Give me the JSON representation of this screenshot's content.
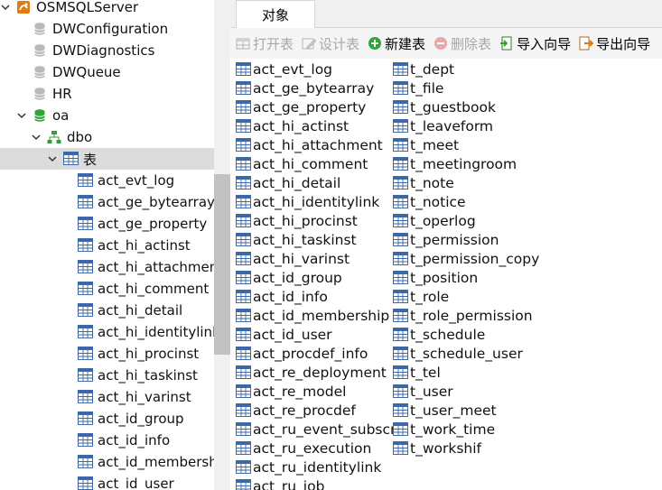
{
  "tree": {
    "items": [
      {
        "label": "OSMSQLServer",
        "level": 0,
        "arrow": "down",
        "icon": "server-icon"
      },
      {
        "label": "DWConfiguration",
        "level": 1,
        "arrow": "none",
        "icon": "database-gray-icon"
      },
      {
        "label": "DWDiagnostics",
        "level": 1,
        "arrow": "none",
        "icon": "database-gray-icon"
      },
      {
        "label": "DWQueue",
        "level": 1,
        "arrow": "none",
        "icon": "database-gray-icon"
      },
      {
        "label": "HR",
        "level": 1,
        "arrow": "none",
        "icon": "database-gray-icon"
      },
      {
        "label": "oa",
        "level": 1,
        "arrow": "down",
        "icon": "database-green-icon"
      },
      {
        "label": "dbo",
        "level": 2,
        "arrow": "down",
        "icon": "schema-icon"
      },
      {
        "label": "表",
        "level": 3,
        "arrow": "down",
        "icon": "table-icon",
        "selected": true
      },
      {
        "label": "act_evt_log",
        "level": 4,
        "arrow": "none",
        "icon": "table-icon"
      },
      {
        "label": "act_ge_bytearray",
        "level": 4,
        "arrow": "none",
        "icon": "table-icon"
      },
      {
        "label": "act_ge_property",
        "level": 4,
        "arrow": "none",
        "icon": "table-icon"
      },
      {
        "label": "act_hi_actinst",
        "level": 4,
        "arrow": "none",
        "icon": "table-icon"
      },
      {
        "label": "act_hi_attachment",
        "level": 4,
        "arrow": "none",
        "icon": "table-icon"
      },
      {
        "label": "act_hi_comment",
        "level": 4,
        "arrow": "none",
        "icon": "table-icon"
      },
      {
        "label": "act_hi_detail",
        "level": 4,
        "arrow": "none",
        "icon": "table-icon"
      },
      {
        "label": "act_hi_identitylink",
        "level": 4,
        "arrow": "none",
        "icon": "table-icon"
      },
      {
        "label": "act_hi_procinst",
        "level": 4,
        "arrow": "none",
        "icon": "table-icon"
      },
      {
        "label": "act_hi_taskinst",
        "level": 4,
        "arrow": "none",
        "icon": "table-icon"
      },
      {
        "label": "act_hi_varinst",
        "level": 4,
        "arrow": "none",
        "icon": "table-icon"
      },
      {
        "label": "act_id_group",
        "level": 4,
        "arrow": "none",
        "icon": "table-icon"
      },
      {
        "label": "act_id_info",
        "level": 4,
        "arrow": "none",
        "icon": "table-icon"
      },
      {
        "label": "act_id_membership",
        "level": 4,
        "arrow": "none",
        "icon": "table-icon"
      },
      {
        "label": "act_id_user",
        "level": 4,
        "arrow": "none",
        "icon": "table-icon"
      }
    ]
  },
  "tabs": [
    {
      "label": "对象"
    }
  ],
  "toolbar": {
    "open_table": "打开表",
    "design_table": "设计表",
    "new_table": "新建表",
    "delete_table": "删除表",
    "import_wizard": "导入向导",
    "export_wizard": "导出向导"
  },
  "tables_col1": [
    "act_evt_log",
    "act_ge_bytearray",
    "act_ge_property",
    "act_hi_actinst",
    "act_hi_attachment",
    "act_hi_comment",
    "act_hi_detail",
    "act_hi_identitylink",
    "act_hi_procinst",
    "act_hi_taskinst",
    "act_hi_varinst",
    "act_id_group",
    "act_id_info",
    "act_id_membership",
    "act_id_user",
    "act_procdef_info",
    "act_re_deployment",
    "act_re_model",
    "act_re_procdef",
    "act_ru_event_subscr",
    "act_ru_execution",
    "act_ru_identitylink",
    "act_ru_job"
  ],
  "tables_col2": [
    "t_dept",
    "t_file",
    "t_guestbook",
    "t_leaveform",
    "t_meet",
    "t_meetingroom",
    "t_note",
    "t_notice",
    "t_operlog",
    "t_permission",
    "t_permission_copy",
    "t_position",
    "t_role",
    "t_role_permission",
    "t_schedule",
    "t_schedule_user",
    "t_tel",
    "t_user",
    "t_user_meet",
    "t_work_time",
    "t_workshif"
  ],
  "colors": {
    "table_icon": "#3a68a8",
    "db_green": "#2fa53a",
    "db_gray": "#b9b9b9",
    "schema": "#3a9a3a",
    "server": "#e27a12",
    "selected_bg": "#dcdcdc"
  }
}
